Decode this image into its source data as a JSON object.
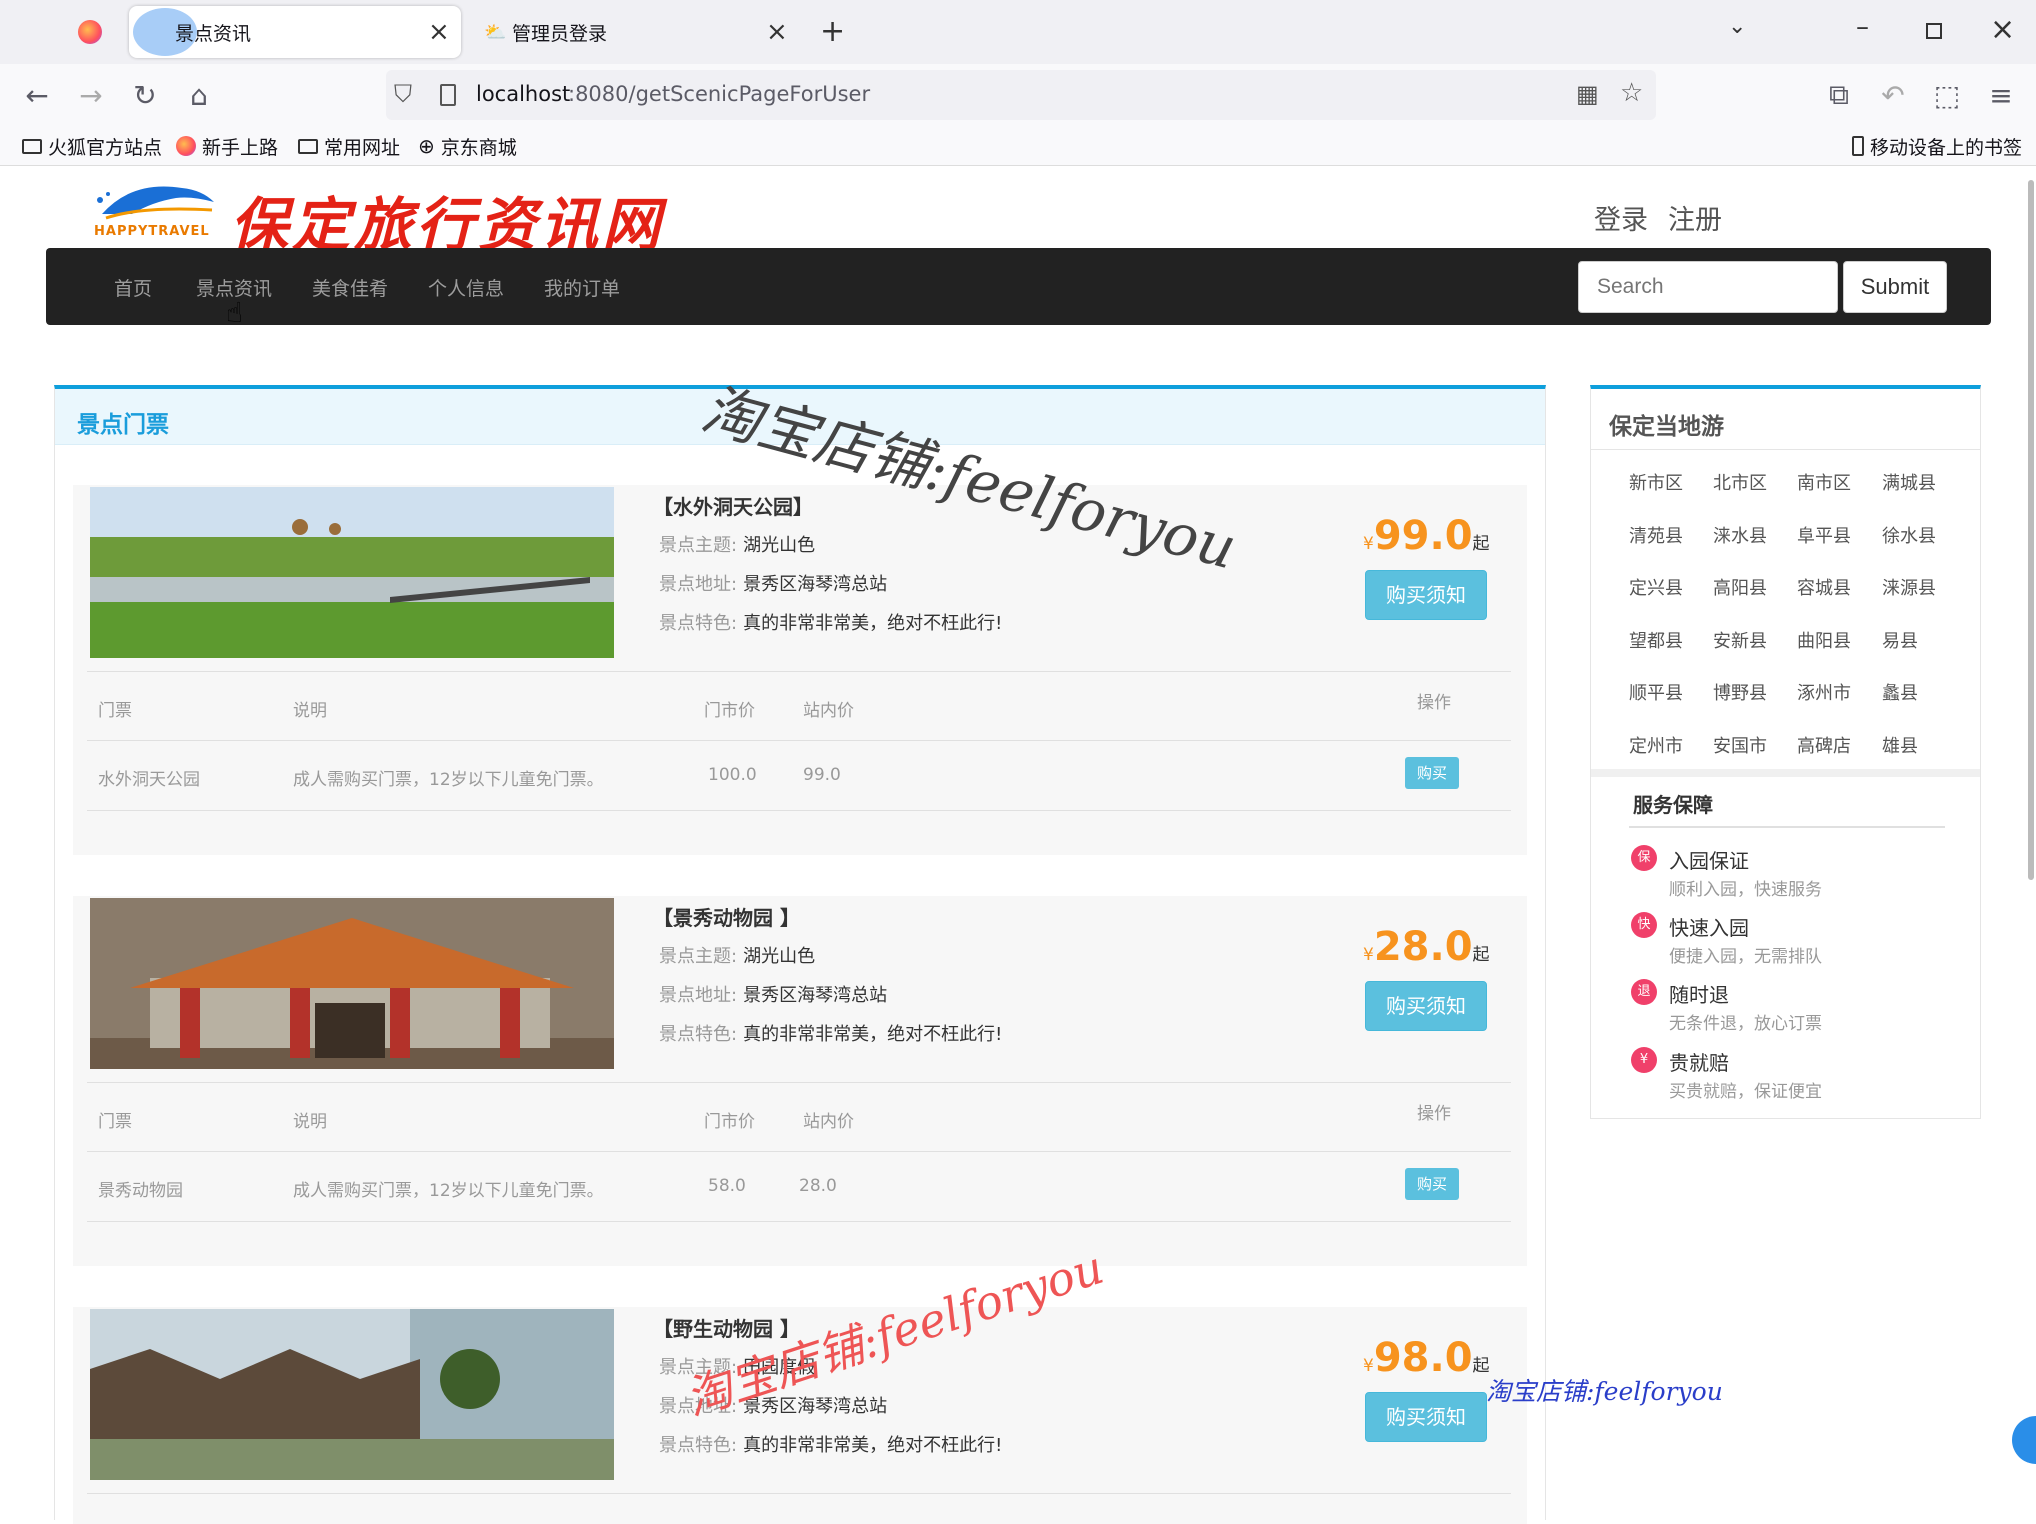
{
  "browser": {
    "tabs": [
      {
        "label": "景点资讯",
        "active": true
      },
      {
        "label": "管理员登录",
        "active": false
      }
    ],
    "url": {
      "host": "localhost",
      "path": ":8080/getScenicPageForUser"
    },
    "bookmarks": [
      "火狐官方站点",
      "新手上路",
      "常用网址",
      "京东商城"
    ],
    "mobile_bookmarks": "移动设备上的书签"
  },
  "site": {
    "logo_text": "保定旅行资讯网",
    "logo_sub": "HAPPYTRAVEL",
    "login": "登录",
    "register": "注册",
    "nav": [
      "首页",
      "景点资讯",
      "美食佳肴",
      "个人信息",
      "我的订单"
    ],
    "search_placeholder": "Search",
    "submit": "Submit"
  },
  "main": {
    "section_title": "景点门票",
    "labels": {
      "theme": "景点主题:",
      "address": "景点地址:",
      "feature": "景点特色:"
    },
    "table_headers": {
      "ticket": "门票",
      "desc": "说明",
      "market": "门市价",
      "site": "站内价",
      "op": "操作"
    },
    "currency": "¥",
    "price_suffix": "起",
    "notice_btn": "购买须知",
    "buy_btn": "购买",
    "cards": [
      {
        "name": "【水外洞天公园】",
        "theme": "湖光山色",
        "address": "景秀区海琴湾总站",
        "feature": "真的非常非常美，绝对不枉此行!",
        "price": "99.0",
        "ticket": {
          "name": "水外洞天公园",
          "desc": "成人需购买门票，12岁以下儿童免门票。",
          "market": "100.0",
          "site": "99.0"
        }
      },
      {
        "name": "【景秀动物园 】",
        "theme": "湖光山色",
        "address": "景秀区海琴湾总站",
        "feature": "真的非常非常美，绝对不枉此行!",
        "price": "28.0",
        "ticket": {
          "name": "景秀动物园",
          "desc": "成人需购买门票，12岁以下儿童免门票。",
          "market": "58.0",
          "site": "28.0"
        }
      },
      {
        "name": "【野生动物园 】",
        "theme": "田园度假",
        "address": "景秀区海琴湾总站",
        "feature": "真的非常非常美，绝对不枉此行!",
        "price": "98.0"
      }
    ]
  },
  "sidebar": {
    "title": "保定当地游",
    "districts": [
      "新市区",
      "北市区",
      "南市区",
      "满城县",
      "清苑县",
      "涞水县",
      "阜平县",
      "徐水县",
      "定兴县",
      "高阳县",
      "容城县",
      "涞源县",
      "望都县",
      "安新县",
      "曲阳县",
      "易县",
      "顺平县",
      "博野县",
      "涿州市",
      "蠡县",
      "定州市",
      "安国市",
      "高碑店",
      "雄县"
    ],
    "service_title": "服务保障",
    "services": [
      {
        "icon": "保",
        "name": "入园保证",
        "desc": "顺利入园，快速服务"
      },
      {
        "icon": "快",
        "name": "快速入园",
        "desc": "便捷入园，无需排队"
      },
      {
        "icon": "退",
        "name": "随时退",
        "desc": "无条件退，放心订票"
      },
      {
        "icon": "¥",
        "name": "贵就赔",
        "desc": "买贵就赔，保证便宜"
      }
    ]
  },
  "watermarks": [
    "淘宝店铺:feelforyou",
    "淘宝店铺:feelforyou",
    "淘宝店铺:feelforyou"
  ]
}
